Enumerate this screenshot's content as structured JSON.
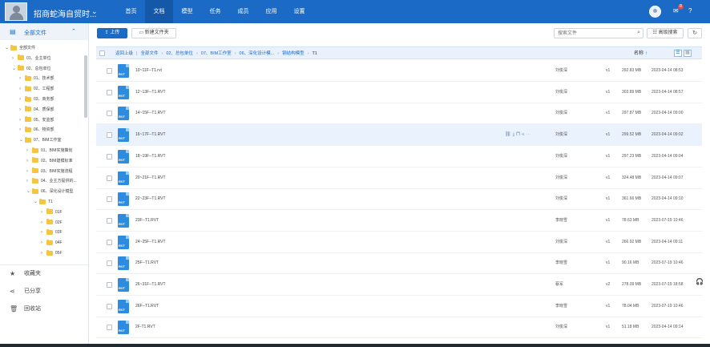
{
  "header": {
    "project_title": "招商蛇海自贸时...",
    "nav": [
      "首页",
      "文档",
      "模型",
      "任务",
      "成员",
      "应用",
      "设置"
    ],
    "active_nav": "文档",
    "message_badge": "8",
    "accent": "#1b6bc6"
  },
  "sidebar": {
    "root_label": "全部文件",
    "tree": [
      {
        "label": "全部文件",
        "level": 0,
        "expanded": true
      },
      {
        "label": "01、业主单位",
        "level": 1,
        "expanded": false
      },
      {
        "label": "02、总包单位",
        "level": 1,
        "expanded": true
      },
      {
        "label": "01、技术部",
        "level": 2,
        "expanded": false
      },
      {
        "label": "02、工程部",
        "level": 2,
        "expanded": false
      },
      {
        "label": "03、商务部",
        "level": 2,
        "expanded": false
      },
      {
        "label": "04、质保部",
        "level": 2,
        "expanded": false
      },
      {
        "label": "05、安监部",
        "level": 2,
        "expanded": false
      },
      {
        "label": "06、物资部",
        "level": 2,
        "expanded": false
      },
      {
        "label": "07、BIM工作室",
        "level": 2,
        "expanded": true
      },
      {
        "label": "01、BIM实施策划",
        "level": 3,
        "expanded": false
      },
      {
        "label": "02、BIM建模标准",
        "level": 3,
        "expanded": false
      },
      {
        "label": "03、BIM实施流程",
        "level": 3,
        "expanded": false
      },
      {
        "label": "04、业主方提供的...",
        "level": 3,
        "expanded": false
      },
      {
        "label": "06、深化设计模型",
        "level": 3,
        "expanded": true
      },
      {
        "label": "T1",
        "level": 4,
        "expanded": true
      },
      {
        "label": "01F",
        "level": 5,
        "expanded": false
      },
      {
        "label": "02F",
        "level": 5,
        "expanded": false
      },
      {
        "label": "03F",
        "level": 5,
        "expanded": false
      },
      {
        "label": "04F",
        "level": 5,
        "expanded": false
      },
      {
        "label": "05F",
        "level": 5,
        "expanded": false
      }
    ],
    "footer": [
      {
        "label": "收藏夹",
        "icon": "star-icon"
      },
      {
        "label": "已分享",
        "icon": "share-icon"
      },
      {
        "label": "回收站",
        "icon": "trash-icon"
      }
    ]
  },
  "toolbar": {
    "upload_label": "上传",
    "new_folder_label": "新建文件夹",
    "search_placeholder": "搜索文件",
    "advanced_search_label": "高级搜索"
  },
  "breadcrumb": {
    "back_label": "返回上级",
    "items": [
      "全部文件",
      "02、总包单位",
      "07、BIM工作室",
      "06、深化设计模...",
      "钢结构模型",
      "T1"
    ],
    "sort_label": "名称"
  },
  "files": [
    {
      "name": "10~11F--T1.rvt",
      "owner": "刘俊深",
      "version": "v1",
      "size": "292.83 MB",
      "date": "2023-04-14 08:53"
    },
    {
      "name": "12~13F--T1.RVT",
      "owner": "刘俊深",
      "version": "v1",
      "size": "303.89 MB",
      "date": "2023-04-14 08:57"
    },
    {
      "name": "14~15F--T1.RVT",
      "owner": "刘俊深",
      "version": "v1",
      "size": "297.87 MB",
      "date": "2023-04-14 09:00"
    },
    {
      "name": "16~17F--T1.RVT",
      "owner": "刘俊深",
      "version": "v1",
      "size": "299.52 MB",
      "date": "2023-04-14 09:02"
    },
    {
      "name": "18~19F--T1.RVT",
      "owner": "刘俊深",
      "version": "v1",
      "size": "297.23 MB",
      "date": "2023-04-14 09:04"
    },
    {
      "name": "20~21F--T1.RVT",
      "owner": "刘俊深",
      "version": "v1",
      "size": "324.48 MB",
      "date": "2023-04-14 09:07"
    },
    {
      "name": "22~23F--T1.RVT",
      "owner": "刘俊深",
      "version": "v1",
      "size": "361.66 MB",
      "date": "2023-04-14 09:10"
    },
    {
      "name": "23F--T1.RVT",
      "owner": "李晓雪",
      "version": "v1",
      "size": "78.63 MB",
      "date": "2023-07-19 10:46"
    },
    {
      "name": "24~25F--T1.RVT",
      "owner": "刘俊深",
      "version": "v1",
      "size": "266.92 MB",
      "date": "2023-04-14 09:11"
    },
    {
      "name": "25F--T1.RVT",
      "owner": "李晓雪",
      "version": "v1",
      "size": "90.16 MB",
      "date": "2023-07-19 10:46"
    },
    {
      "name": "26~31F--T1.RVT",
      "owner": "蔡军",
      "version": "v2",
      "size": "278.09 MB",
      "date": "2023-07-19 18:58"
    },
    {
      "name": "26F--T1.RVT",
      "owner": "李晓雪",
      "version": "v1",
      "size": "78.04 MB",
      "date": "2023-07-19 10:46"
    },
    {
      "name": "2F-T1.RVT",
      "owner": "刘俊深",
      "version": "v1",
      "size": "51.18 MB",
      "date": "2023-04-14 09:14"
    }
  ],
  "highlighted_row": 3
}
